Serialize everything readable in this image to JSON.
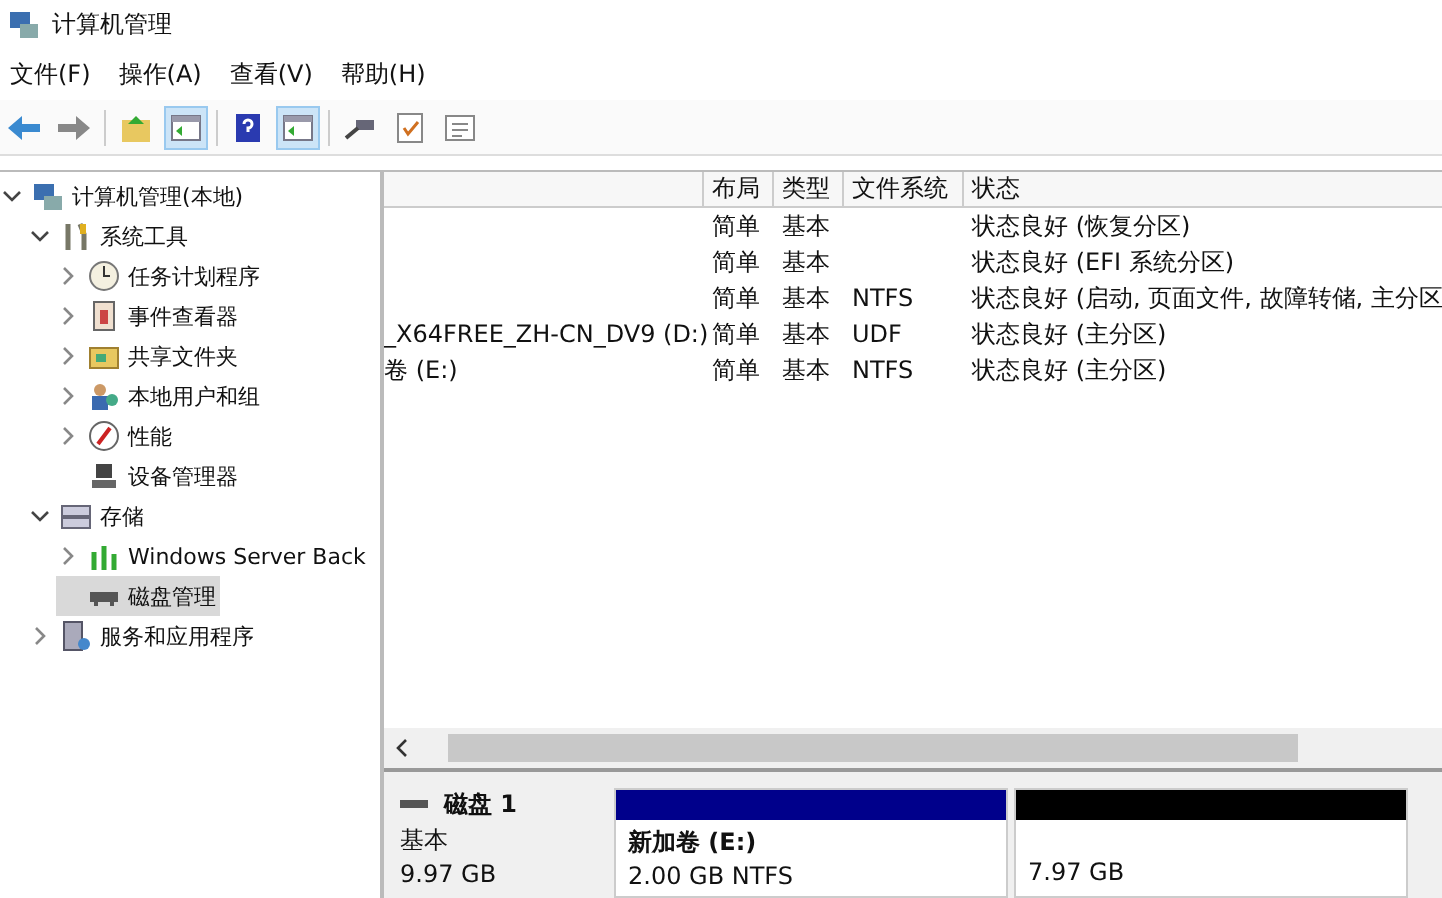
{
  "window": {
    "title": "计算机管理"
  },
  "menu": [
    "文件(F)",
    "操作(A)",
    "查看(V)",
    "帮助(H)"
  ],
  "toolbar": [
    {
      "kind": "back"
    },
    {
      "kind": "forward"
    },
    {
      "kind": "sep"
    },
    {
      "kind": "up"
    },
    {
      "kind": "pane",
      "selected": true
    },
    {
      "kind": "sep"
    },
    {
      "kind": "help"
    },
    {
      "kind": "pane",
      "selected": true
    },
    {
      "kind": "sep"
    },
    {
      "kind": "connect"
    },
    {
      "kind": "check"
    },
    {
      "kind": "list"
    }
  ],
  "tree": [
    {
      "label": "计算机管理(本地)",
      "kind": "computer",
      "expanded": true,
      "selected": false,
      "children": [
        {
          "label": "系统工具",
          "kind": "tools",
          "expanded": true,
          "selected": false,
          "children": [
            {
              "label": "任务计划程序",
              "kind": "clock",
              "expanded": false,
              "selected": false
            },
            {
              "label": "事件查看器",
              "kind": "log",
              "expanded": false,
              "selected": false
            },
            {
              "label": "共享文件夹",
              "kind": "folder",
              "expanded": false,
              "selected": false
            },
            {
              "label": "本地用户和组",
              "kind": "users",
              "expanded": false,
              "selected": false
            },
            {
              "label": "性能",
              "kind": "gauge",
              "expanded": false,
              "selected": false
            },
            {
              "label": "设备管理器",
              "kind": "device",
              "selected": false
            }
          ]
        },
        {
          "label": "存储",
          "kind": "storage",
          "expanded": true,
          "selected": false,
          "children": [
            {
              "label": "Windows Server Back",
              "kind": "backup",
              "expanded": false,
              "selected": false
            },
            {
              "label": "磁盘管理",
              "kind": "disk",
              "selected": true
            }
          ]
        },
        {
          "label": "服务和应用程序",
          "kind": "services",
          "expanded": false,
          "selected": false
        }
      ]
    }
  ],
  "table": {
    "columns": [
      "布局",
      "类型",
      "文件系统",
      "状态"
    ],
    "rows": [
      {
        "cells": [
          "简单",
          "基本",
          "",
          "状态良好 (恢复分区)"
        ]
      },
      {
        "cells": [
          "简单",
          "基本",
          "",
          "状态良好 (EFI 系统分区)"
        ]
      },
      {
        "cells": [
          "简单",
          "基本",
          "NTFS",
          "状态良好 (启动, 页面文件, 故障转储, 主分区"
        ]
      },
      {
        "column_1": "_X64FREE_ZH-CN_DV9 (D:)",
        "cells": [
          "简单",
          "基本",
          "UDF",
          "状态良好 (主分区)"
        ]
      },
      {
        "column_1": "卷 (E:)",
        "cells": [
          "简单",
          "基本",
          "NTFS",
          "状态良好 (主分区)"
        ]
      }
    ]
  },
  "disk": {
    "name": "磁盘 1",
    "type": "基本",
    "size": "9.97 GB",
    "partitions": [
      {
        "label": "新加卷 (E:)",
        "detail": "2.00 GB NTFS",
        "color": "#00008b"
      },
      {
        "detail": "7.97 GB",
        "color": "#000000"
      }
    ]
  }
}
